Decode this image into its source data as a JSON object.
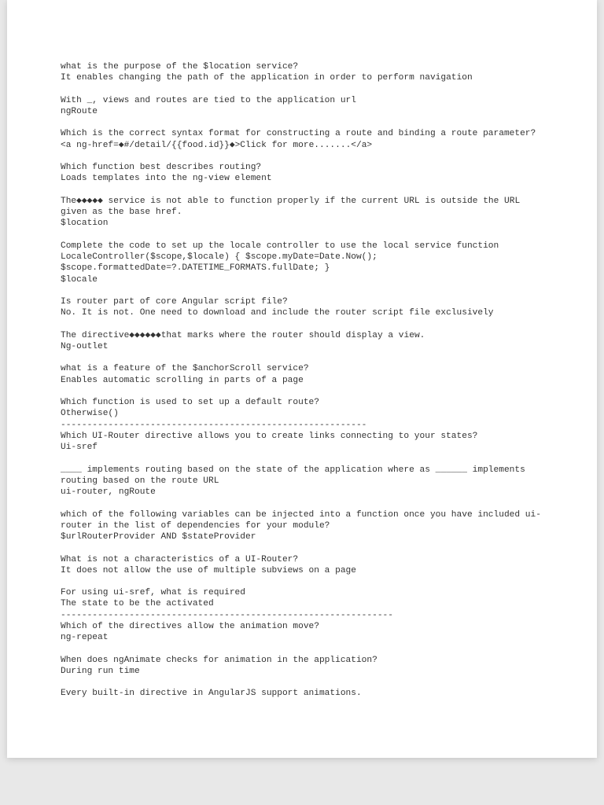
{
  "qa": [
    {
      "q": "what is the purpose of the $location service?",
      "a": "It enables changing the path of the application in order to perform navigation"
    },
    {
      "q": "With _, views and routes are tied to the application url",
      "a": "ngRoute"
    },
    {
      "q": "Which is the correct syntax format for constructing a route and binding a route parameter?",
      "a": "<a ng-href=◆#/detail/{{food.id}}◆>Click for more.......</a>"
    },
    {
      "q": "Which function best describes routing?",
      "a": "Loads templates into the ng-view element"
    },
    {
      "q": "The◆◆◆◆◆ service is not able to function properly if the current URL is outside the URL given as the base href.",
      "a": "$location"
    },
    {
      "q": "Complete the code to set up the locale controller to use the local service function LocaleController($scope,$locale) { $scope.myDate=Date.Now(); $scope.formattedDate=?.DATETIME_FORMATS.fullDate; }",
      "a": "$locale"
    },
    {
      "q": "Is router part of core Angular script file?",
      "a": "No. It is not. One need to download and include the router script file exclusively"
    },
    {
      "q": "The directive◆◆◆◆◆◆that marks where the router should display a view.",
      "a": "Ng-outlet"
    },
    {
      "q": "what is a feature of the $anchorScroll service?",
      "a": "Enables automatic scrolling in parts of a page"
    },
    {
      "q": "Which function is used to set up a default route?",
      "a": "Otherwise()\n----------------------------------------------------------"
    },
    {
      "q": "Which UI-Router directive allows you to create links connecting to your states?",
      "a": "Ui-sref"
    },
    {
      "q": "____ implements routing based on the state of the application where as ______ implements routing based on the route URL",
      "a": "ui-router, ngRoute"
    },
    {
      "q": "which of the following variables can be injected into a function once you have included ui-router in the list of dependencies for your module?",
      "a": "$urlRouterProvider AND $stateProvider"
    },
    {
      "q": "What is not a characteristics of a UI-Router?",
      "a": "It does not allow the use of multiple subviews on a page"
    },
    {
      "q": "For using ui-sref, what is required",
      "a": "The state to be the activated\n---------------------------------------------------------------"
    },
    {
      "q": "Which of the directives allow the animation move?",
      "a": "ng-repeat"
    },
    {
      "q": "When does ngAnimate checks for animation in the application?",
      "a": "During run time"
    },
    {
      "q": "",
      "a": "Every built-in directive in AngularJS support animations."
    }
  ]
}
